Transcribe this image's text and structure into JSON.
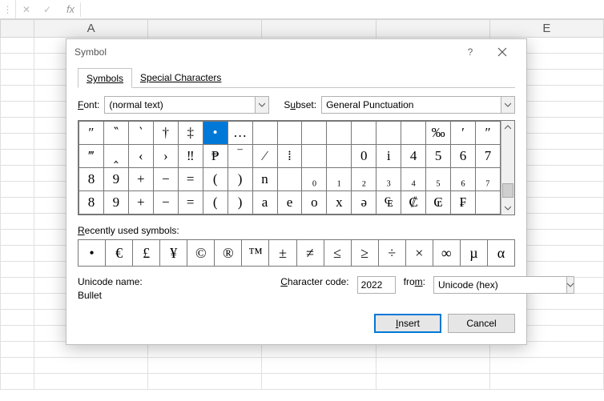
{
  "formula_bar": {
    "cancel_glyph": "✕",
    "accept_glyph": "✓",
    "fx": "fx"
  },
  "columns": [
    "A",
    "",
    "",
    "",
    "E"
  ],
  "dialog": {
    "title": "Symbol",
    "help": "?",
    "tabs": {
      "symbols": "Symbols",
      "special": "Special Characters"
    },
    "font_label": "Font:",
    "font_value": "(normal text)",
    "subset_label": "Subset:",
    "subset_value": "General Punctuation",
    "grid": [
      [
        "″",
        "‶",
        "‵",
        "†",
        "‡",
        "•",
        "…",
        "",
        "",
        "",
        "",
        "",
        "",
        "",
        "‰",
        "′",
        "″"
      ],
      [
        "‴",
        "‸",
        "‹",
        "›",
        "‼",
        "₱",
        "‾",
        "⁄",
        "⁞",
        "",
        "",
        "0",
        "i",
        "4",
        "5",
        "6",
        "7"
      ],
      [
        "8",
        "9",
        "+",
        "−",
        "=",
        "(",
        ")",
        "n",
        "",
        "₀",
        "₁",
        "₂",
        "₃",
        "₄",
        "₅",
        "₆",
        "₇"
      ],
      [
        "8",
        "9",
        "+",
        "−",
        "=",
        "(",
        ")",
        "a",
        "e",
        "o",
        "x",
        "ə",
        "₠",
        "₡",
        "₢",
        "₣",
        ""
      ]
    ],
    "grid_selected": {
      "row": 0,
      "col": 5
    },
    "recent_label": "Recently used symbols:",
    "recent": [
      "•",
      "€",
      "£",
      "¥",
      "©",
      "®",
      "™",
      "±",
      "≠",
      "≤",
      "≥",
      "÷",
      "×",
      "∞",
      "µ",
      "α"
    ],
    "unicode_name_label": "Unicode name:",
    "unicode_name_value": "Bullet",
    "charcode_label": "Character code:",
    "charcode_value": "2022",
    "from_label": "from:",
    "from_value": "Unicode (hex)",
    "insert": "Insert",
    "cancel": "Cancel"
  }
}
